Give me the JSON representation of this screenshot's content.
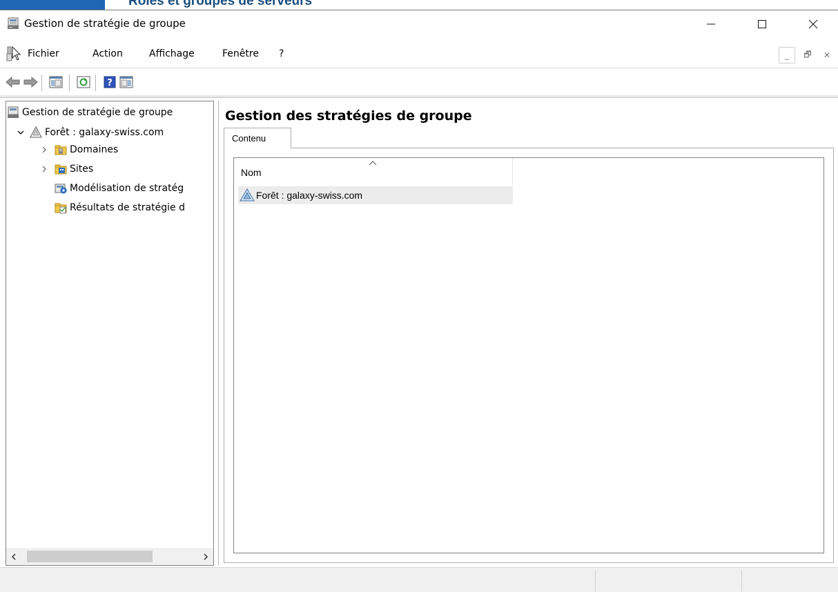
{
  "background_window": {
    "title": "Rôles et groupes de serveurs"
  },
  "window": {
    "title": "Gestion de stratégie de groupe",
    "controls": {
      "minimize": "—",
      "maximize": "☐",
      "close": "✕"
    }
  },
  "menu": {
    "items": [
      "Fichier",
      "Action",
      "Affichage",
      "Fenêtre",
      "?"
    ],
    "mdi": {
      "minimize": "_",
      "restore": "🗗",
      "close": "✕"
    }
  },
  "toolbar": {
    "buttons": [
      "back-icon",
      "forward-icon",
      "show-hide-console-tree-icon",
      "refresh-icon",
      "help-icon",
      "show-hide-action-pane-icon"
    ]
  },
  "tree": {
    "root": "Gestion de stratégie de groupe",
    "forest": "Forêt : galaxy-swiss.com",
    "children": [
      "Domaines",
      "Sites",
      "Modélisation de stratég",
      "Résultats de stratégie d"
    ]
  },
  "content": {
    "heading": "Gestion des stratégies de groupe",
    "tab": "Contenu",
    "column": "Nom",
    "rows": [
      "Forêt : galaxy-swiss.com"
    ]
  },
  "colors": {
    "accent_blue": "#1f66b5",
    "selection_gray": "#ececec",
    "border": "#828282"
  }
}
